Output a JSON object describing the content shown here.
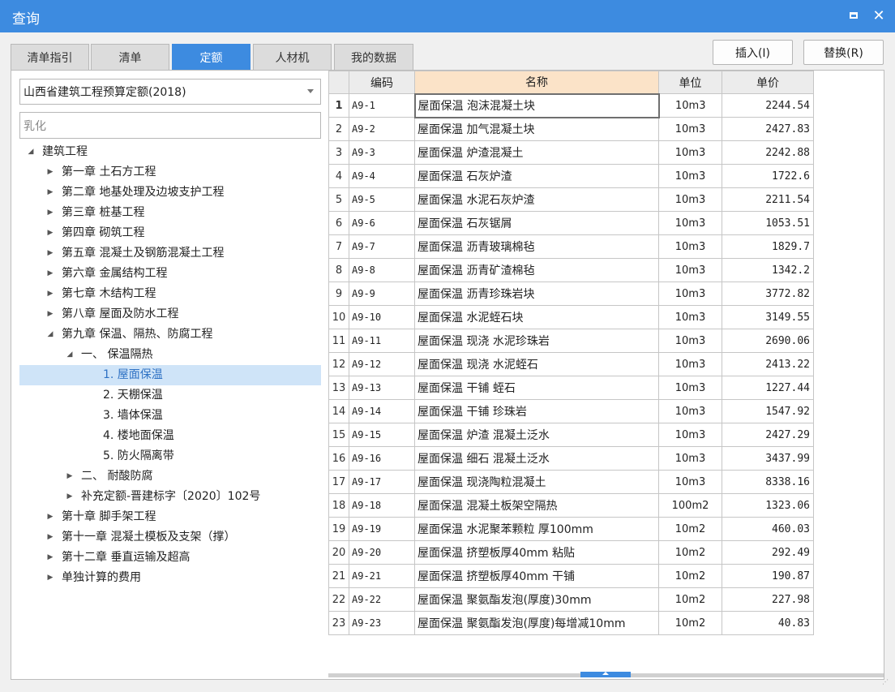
{
  "window": {
    "title": "查询"
  },
  "tabs": [
    {
      "label": "清单指引",
      "active": false
    },
    {
      "label": "清单",
      "active": false
    },
    {
      "label": "定额",
      "active": true
    },
    {
      "label": "人材机",
      "active": false
    },
    {
      "label": "我的数据",
      "active": false
    }
  ],
  "buttons": {
    "insert": "插入(I)",
    "replace": "替换(R)"
  },
  "library": {
    "selected": "山西省建筑工程预算定额(2018)"
  },
  "search": {
    "value": "乳化"
  },
  "tree": [
    {
      "label": "建筑工程",
      "level": 0,
      "state": "expanded"
    },
    {
      "label": "第一章 土石方工程",
      "level": 1,
      "state": "collapsed"
    },
    {
      "label": "第二章 地基处理及边坡支护工程",
      "level": 1,
      "state": "collapsed"
    },
    {
      "label": "第三章 桩基工程",
      "level": 1,
      "state": "collapsed"
    },
    {
      "label": "第四章 砌筑工程",
      "level": 1,
      "state": "collapsed"
    },
    {
      "label": "第五章 混凝土及钢筋混凝土工程",
      "level": 1,
      "state": "collapsed"
    },
    {
      "label": "第六章 金属结构工程",
      "level": 1,
      "state": "collapsed"
    },
    {
      "label": "第七章 木结构工程",
      "level": 1,
      "state": "collapsed"
    },
    {
      "label": "第八章 屋面及防水工程",
      "level": 1,
      "state": "collapsed"
    },
    {
      "label": "第九章 保温、隔热、防腐工程",
      "level": 1,
      "state": "expanded"
    },
    {
      "label": "一、 保温隔热",
      "level": 2,
      "state": "expanded"
    },
    {
      "label": "1. 屋面保温",
      "level": 3,
      "state": "leaf",
      "selected": true
    },
    {
      "label": "2. 天棚保温",
      "level": 3,
      "state": "leaf"
    },
    {
      "label": "3. 墙体保温",
      "level": 3,
      "state": "leaf"
    },
    {
      "label": "4. 楼地面保温",
      "level": 3,
      "state": "leaf"
    },
    {
      "label": "5. 防火隔离带",
      "level": 3,
      "state": "leaf"
    },
    {
      "label": "二、 耐酸防腐",
      "level": 2,
      "state": "collapsed"
    },
    {
      "label": "补充定额-晋建标字〔2020〕102号",
      "level": 2,
      "state": "collapsed"
    },
    {
      "label": "第十章 脚手架工程",
      "level": 1,
      "state": "collapsed"
    },
    {
      "label": "第十一章 混凝土模板及支架（撑）",
      "level": 1,
      "state": "collapsed"
    },
    {
      "label": "第十二章 垂直运输及超高",
      "level": 1,
      "state": "collapsed"
    },
    {
      "label": "单独计算的费用",
      "level": 1,
      "state": "collapsed"
    }
  ],
  "grid": {
    "columns": [
      "",
      "编码",
      "名称",
      "单位",
      "单价"
    ],
    "rows": [
      [
        "1",
        "A9-1",
        "屋面保温 泡沫混凝土块",
        "10m3",
        "2244.54"
      ],
      [
        "2",
        "A9-2",
        "屋面保温 加气混凝土块",
        "10m3",
        "2427.83"
      ],
      [
        "3",
        "A9-3",
        "屋面保温 炉渣混凝土",
        "10m3",
        "2242.88"
      ],
      [
        "4",
        "A9-4",
        "屋面保温 石灰炉渣",
        "10m3",
        "1722.6"
      ],
      [
        "5",
        "A9-5",
        "屋面保温 水泥石灰炉渣",
        "10m3",
        "2211.54"
      ],
      [
        "6",
        "A9-6",
        "屋面保温 石灰锯屑",
        "10m3",
        "1053.51"
      ],
      [
        "7",
        "A9-7",
        "屋面保温 沥青玻璃棉毡",
        "10m3",
        "1829.7"
      ],
      [
        "8",
        "A9-8",
        "屋面保温 沥青矿渣棉毡",
        "10m3",
        "1342.2"
      ],
      [
        "9",
        "A9-9",
        "屋面保温 沥青珍珠岩块",
        "10m3",
        "3772.82"
      ],
      [
        "10",
        "A9-10",
        "屋面保温 水泥蛭石块",
        "10m3",
        "3149.55"
      ],
      [
        "11",
        "A9-11",
        "屋面保温 现浇 水泥珍珠岩",
        "10m3",
        "2690.06"
      ],
      [
        "12",
        "A9-12",
        "屋面保温 现浇 水泥蛭石",
        "10m3",
        "2413.22"
      ],
      [
        "13",
        "A9-13",
        "屋面保温 干铺 蛭石",
        "10m3",
        "1227.44"
      ],
      [
        "14",
        "A9-14",
        "屋面保温 干铺 珍珠岩",
        "10m3",
        "1547.92"
      ],
      [
        "15",
        "A9-15",
        "屋面保温 炉渣 混凝土泛水",
        "10m3",
        "2427.29"
      ],
      [
        "16",
        "A9-16",
        "屋面保温 细石 混凝土泛水",
        "10m3",
        "3437.99"
      ],
      [
        "17",
        "A9-17",
        "屋面保温 现浇陶粒混凝土",
        "10m3",
        "8338.16"
      ],
      [
        "18",
        "A9-18",
        "屋面保温 混凝土板架空隔热",
        "100m2",
        "1323.06"
      ],
      [
        "19",
        "A9-19",
        "屋面保温 水泥聚苯颗粒 厚100mm",
        "10m2",
        "460.03"
      ],
      [
        "20",
        "A9-20",
        "屋面保温 挤塑板厚40mm 粘贴",
        "10m2",
        "292.49"
      ],
      [
        "21",
        "A9-21",
        "屋面保温 挤塑板厚40mm 干铺",
        "10m2",
        "190.87"
      ],
      [
        "22",
        "A9-22",
        "屋面保温 聚氨酯发泡(厚度)30mm",
        "10m2",
        "227.98"
      ],
      [
        "23",
        "A9-23",
        "屋面保温 聚氨酯发泡(厚度)每增减10mm",
        "10m2",
        "40.83"
      ]
    ]
  },
  "colors": {
    "accent": "#3d8be0",
    "selected_bg": "#cfe4f8",
    "sorted_header": "#fbe3c8"
  }
}
